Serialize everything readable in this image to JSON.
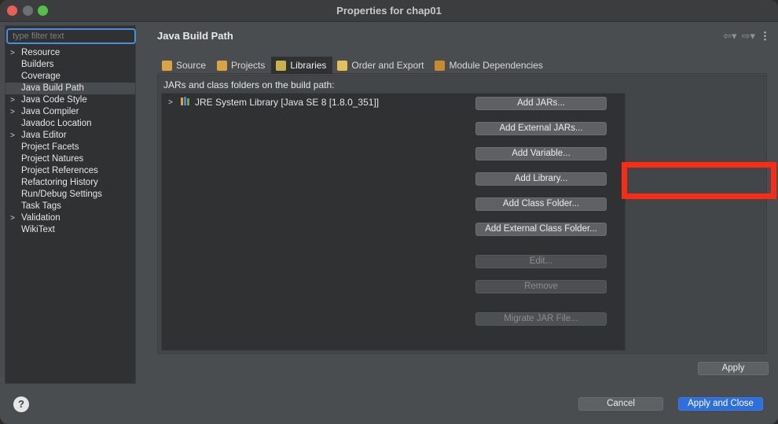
{
  "window": {
    "title": "Properties for chap01"
  },
  "sidebar": {
    "filter_placeholder": "type filter text",
    "items": [
      {
        "label": "Resource",
        "expandable": true
      },
      {
        "label": "Builders",
        "expandable": false
      },
      {
        "label": "Coverage",
        "expandable": false
      },
      {
        "label": "Java Build Path",
        "expandable": false,
        "selected": true
      },
      {
        "label": "Java Code Style",
        "expandable": true
      },
      {
        "label": "Java Compiler",
        "expandable": true
      },
      {
        "label": "Javadoc Location",
        "expandable": false
      },
      {
        "label": "Java Editor",
        "expandable": true
      },
      {
        "label": "Project Facets",
        "expandable": false
      },
      {
        "label": "Project Natures",
        "expandable": false
      },
      {
        "label": "Project References",
        "expandable": false
      },
      {
        "label": "Refactoring History",
        "expandable": false
      },
      {
        "label": "Run/Debug Settings",
        "expandable": false
      },
      {
        "label": "Task Tags",
        "expandable": false
      },
      {
        "label": "Validation",
        "expandable": true
      },
      {
        "label": "WikiText",
        "expandable": false
      }
    ]
  },
  "main": {
    "title": "Java Build Path",
    "tabs": [
      {
        "label": "Source",
        "icon": "source-folder-icon",
        "color": "#d9a441"
      },
      {
        "label": "Projects",
        "icon": "projects-icon",
        "color": "#d9a441"
      },
      {
        "label": "Libraries",
        "icon": "libraries-icon",
        "color": "#c9b24a",
        "active": true
      },
      {
        "label": "Order and Export",
        "icon": "order-export-icon",
        "color": "#e3c15a"
      },
      {
        "label": "Module Dependencies",
        "icon": "module-icon",
        "color": "#c98a2e"
      }
    ],
    "content_label": "JARs and class folders on the build path:",
    "libraries": [
      {
        "label": "JRE System Library [Java SE 8 [1.8.0_351]]"
      }
    ],
    "buttons": {
      "add_jars": "Add JARs...",
      "add_external_jars": "Add External JARs...",
      "add_variable": "Add Variable...",
      "add_library": "Add Library...",
      "add_class_folder": "Add Class Folder...",
      "add_external_class_folder": "Add External Class Folder...",
      "edit": "Edit...",
      "remove": "Remove",
      "migrate_jar": "Migrate JAR File..."
    },
    "apply": "Apply"
  },
  "footer": {
    "help": "?",
    "cancel": "Cancel",
    "apply_and_close": "Apply and Close"
  },
  "colors": {
    "highlight": "#ff2a14",
    "primary_button": "#2e6fe0",
    "focus_ring": "#4a8fd9"
  }
}
